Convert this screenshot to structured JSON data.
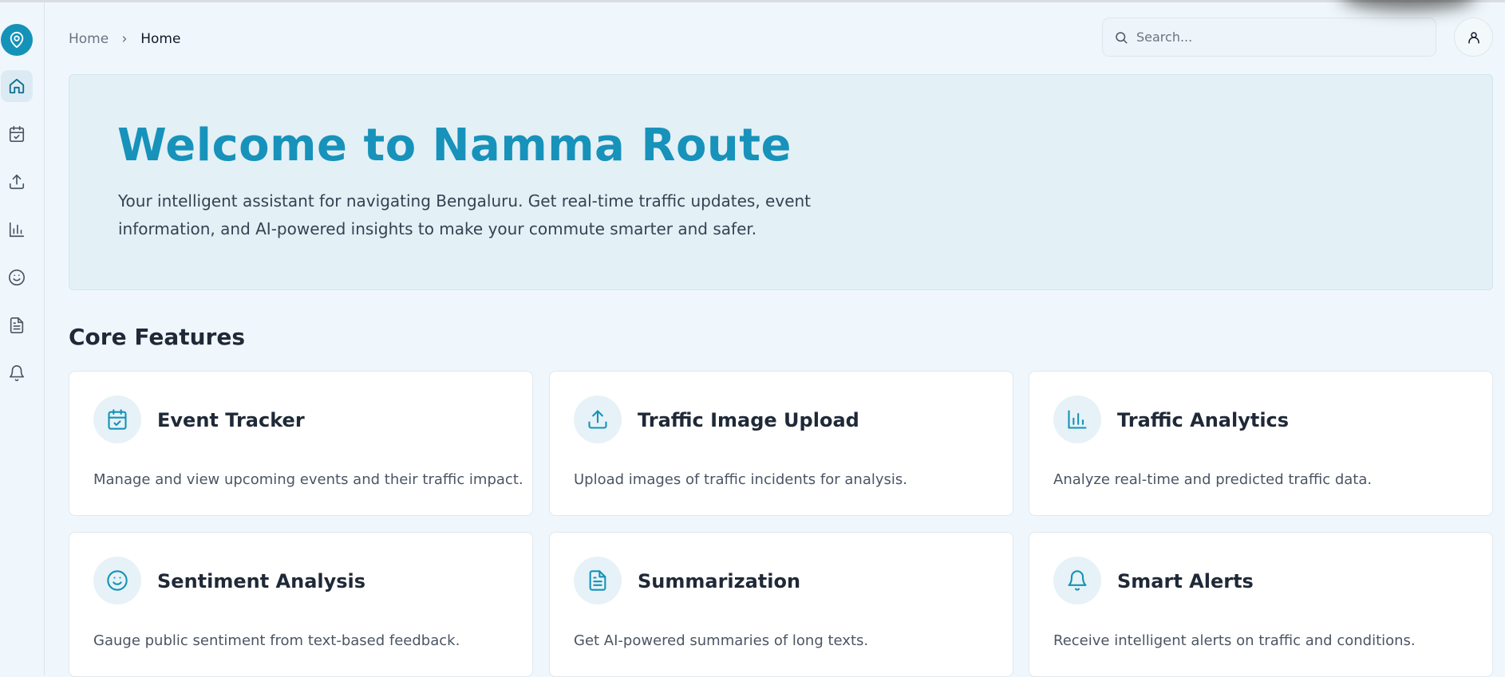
{
  "app": {
    "logo_icon": "map-pin-icon",
    "accent_color": "#1592b8"
  },
  "sidebar": {
    "items": [
      {
        "name": "home",
        "icon": "home-icon",
        "active": true
      },
      {
        "name": "event-tracker",
        "icon": "calendar-check-icon"
      },
      {
        "name": "traffic-image-upload",
        "icon": "upload-icon"
      },
      {
        "name": "traffic-analytics",
        "icon": "bar-chart-icon"
      },
      {
        "name": "sentiment-analysis",
        "icon": "smile-icon"
      },
      {
        "name": "summarization",
        "icon": "file-text-icon"
      },
      {
        "name": "smart-alerts",
        "icon": "bell-icon"
      }
    ]
  },
  "breadcrumb": {
    "root": "Home",
    "current": "Home"
  },
  "search": {
    "placeholder": "Search..."
  },
  "hero": {
    "title": "Welcome to Namma Route",
    "description": "Your intelligent assistant for navigating Bengaluru. Get real-time traffic updates, event information, and AI-powered insights to make your commute smarter and safer."
  },
  "features": {
    "title": "Core Features",
    "cards": [
      {
        "title": "Event Tracker",
        "description": "Manage and view upcoming events and their traffic impact.",
        "icon": "calendar-check-icon"
      },
      {
        "title": "Traffic Image Upload",
        "description": "Upload images of traffic incidents for analysis.",
        "icon": "upload-icon"
      },
      {
        "title": "Traffic Analytics",
        "description": "Analyze real-time and predicted traffic data.",
        "icon": "bar-chart-icon"
      },
      {
        "title": "Sentiment Analysis",
        "description": "Gauge public sentiment from text-based feedback.",
        "icon": "smile-icon"
      },
      {
        "title": "Summarization",
        "description": "Get AI-powered summaries of long texts.",
        "icon": "file-text-icon"
      },
      {
        "title": "Smart Alerts",
        "description": "Receive intelligent alerts on traffic and conditions.",
        "icon": "bell-icon"
      }
    ]
  }
}
